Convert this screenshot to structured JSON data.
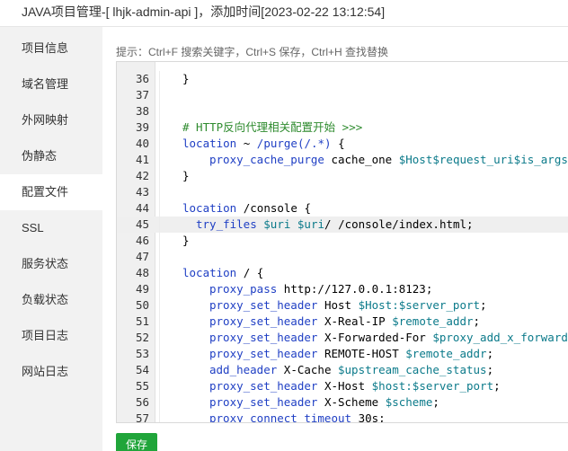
{
  "window": {
    "title": "JAVA项目管理-[ lhjk-admin-api ]，添加时间[2023-02-22 13:12:54]"
  },
  "sidebar": {
    "items": [
      {
        "label": "项目信息"
      },
      {
        "label": "域名管理"
      },
      {
        "label": "外网映射"
      },
      {
        "label": "伪静态"
      },
      {
        "label": "配置文件",
        "active": true
      },
      {
        "label": "SSL"
      },
      {
        "label": "服务状态"
      },
      {
        "label": "负载状态"
      },
      {
        "label": "项目日志"
      },
      {
        "label": "网站日志"
      }
    ]
  },
  "hint": "提示：Ctrl+F 搜索关键字，Ctrl+S 保存，Ctrl+H 查找替换",
  "editor": {
    "current_line": 45,
    "lines": [
      {
        "n": "36",
        "indent": 1,
        "tokens": [
          [
            "p",
            "}"
          ]
        ]
      },
      {
        "n": "37",
        "indent": 1,
        "tokens": []
      },
      {
        "n": "38",
        "indent": 1,
        "tokens": []
      },
      {
        "n": "39",
        "indent": 1,
        "tokens": [
          [
            "cm",
            "# HTTP反向代理相关配置开始 >>>"
          ]
        ]
      },
      {
        "n": "40",
        "indent": 1,
        "tokens": [
          [
            "kw",
            "location"
          ],
          [
            "p",
            " ~ "
          ],
          [
            "st",
            "/purge(/.*)"
          ],
          [
            "p",
            " {"
          ]
        ]
      },
      {
        "n": "41",
        "indent": 2,
        "tokens": [
          [
            "kw",
            "proxy_cache_purge"
          ],
          [
            "p",
            " cache_one "
          ],
          [
            "var",
            "$Host$request_uri$is_args$args"
          ],
          [
            "p",
            ";"
          ]
        ]
      },
      {
        "n": "42",
        "indent": 1,
        "tokens": [
          [
            "p",
            "}"
          ]
        ]
      },
      {
        "n": "43",
        "indent": 1,
        "tokens": []
      },
      {
        "n": "44",
        "indent": 1,
        "tokens": [
          [
            "kw",
            "location"
          ],
          [
            "p",
            " /console {"
          ]
        ]
      },
      {
        "n": "45",
        "indent": 1.5,
        "tokens": [
          [
            "kw",
            "try_files"
          ],
          [
            "p",
            " "
          ],
          [
            "var",
            "$uri"
          ],
          [
            "p",
            " "
          ],
          [
            "var",
            "$uri"
          ],
          [
            "p",
            "/ /console/index.html;"
          ]
        ]
      },
      {
        "n": "46",
        "indent": 1,
        "tokens": [
          [
            "p",
            "}"
          ]
        ]
      },
      {
        "n": "47",
        "indent": 1,
        "tokens": []
      },
      {
        "n": "48",
        "indent": 1,
        "tokens": [
          [
            "kw",
            "location"
          ],
          [
            "p",
            " / {"
          ]
        ]
      },
      {
        "n": "49",
        "indent": 2,
        "tokens": [
          [
            "kw",
            "proxy_pass"
          ],
          [
            "p",
            " http://127.0.0.1:8123;"
          ]
        ]
      },
      {
        "n": "50",
        "indent": 2,
        "tokens": [
          [
            "kw",
            "proxy_set_header"
          ],
          [
            "p",
            " Host "
          ],
          [
            "var",
            "$Host:$server_port"
          ],
          [
            "p",
            ";"
          ]
        ]
      },
      {
        "n": "51",
        "indent": 2,
        "tokens": [
          [
            "kw",
            "proxy_set_header"
          ],
          [
            "p",
            " X-Real-IP "
          ],
          [
            "var",
            "$remote_addr"
          ],
          [
            "p",
            ";"
          ]
        ]
      },
      {
        "n": "52",
        "indent": 2,
        "tokens": [
          [
            "kw",
            "proxy_set_header"
          ],
          [
            "p",
            " X-Forwarded-For "
          ],
          [
            "var",
            "$proxy_add_x_forwarded_for"
          ],
          [
            "p",
            ";"
          ]
        ]
      },
      {
        "n": "53",
        "indent": 2,
        "tokens": [
          [
            "kw",
            "proxy_set_header"
          ],
          [
            "p",
            " REMOTE-HOST "
          ],
          [
            "var",
            "$remote_addr"
          ],
          [
            "p",
            ";"
          ]
        ]
      },
      {
        "n": "54",
        "indent": 2,
        "tokens": [
          [
            "kw",
            "add_header"
          ],
          [
            "p",
            " X-Cache "
          ],
          [
            "var",
            "$upstream_cache_status"
          ],
          [
            "p",
            ";"
          ]
        ]
      },
      {
        "n": "55",
        "indent": 2,
        "tokens": [
          [
            "kw",
            "proxy_set_header"
          ],
          [
            "p",
            " X-Host "
          ],
          [
            "var",
            "$host:$server_port"
          ],
          [
            "p",
            ";"
          ]
        ]
      },
      {
        "n": "56",
        "indent": 2,
        "tokens": [
          [
            "kw",
            "proxy_set_header"
          ],
          [
            "p",
            " X-Scheme "
          ],
          [
            "var",
            "$scheme"
          ],
          [
            "p",
            ";"
          ]
        ]
      },
      {
        "n": "57",
        "indent": 2,
        "tokens": [
          [
            "kw",
            "proxy_connect_timeout"
          ],
          [
            "p",
            " 30s;"
          ]
        ]
      }
    ]
  },
  "save_label": "保存",
  "colors": {
    "save_button": "#20a53a",
    "keyword": "#1f3fc4",
    "variable": "#0b7a8a",
    "comment": "#2e8b2e"
  }
}
